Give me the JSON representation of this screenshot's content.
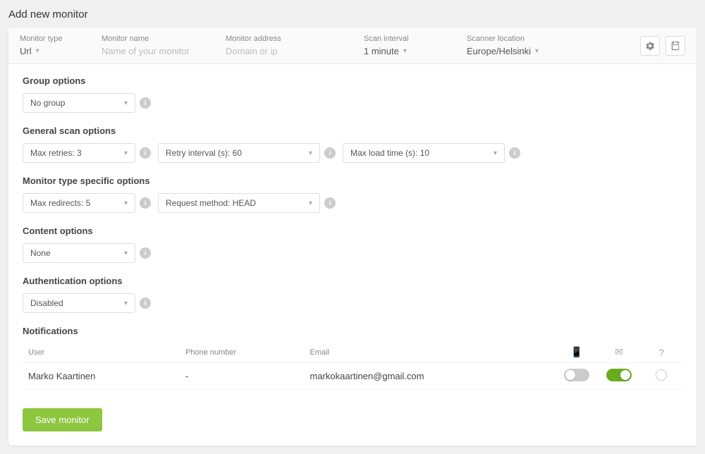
{
  "page": {
    "title": "Add new monitor"
  },
  "top_bar": {
    "monitor_type_label": "Monitor type",
    "monitor_name_label": "Monitor name",
    "monitor_address_label": "Monitor address",
    "scan_interval_label": "Scan interval",
    "scanner_location_label": "Scanner location",
    "monitor_type_value": "Url",
    "monitor_name_placeholder": "Name of your monitor",
    "monitor_address_placeholder": "Domain or ip",
    "scan_interval_value": "1 minute",
    "scanner_location_value": "Europe/Helsinki"
  },
  "sections": {
    "group_options": {
      "title": "Group options",
      "dropdown": "No group"
    },
    "general_scan": {
      "title": "General scan options",
      "max_retries": "Max retries: 3",
      "retry_interval": "Retry interval (s): 60",
      "max_load_time": "Max load time (s): 10"
    },
    "monitor_type_specific": {
      "title": "Monitor type specific options",
      "max_redirects": "Max redirects: 5",
      "request_method": "Request method: HEAD"
    },
    "content_options": {
      "title": "Content options",
      "dropdown": "None"
    },
    "authentication_options": {
      "title": "Authentication options",
      "dropdown": "Disabled"
    },
    "notifications": {
      "title": "Notifications",
      "columns": {
        "user": "User",
        "phone": "Phone number",
        "email": "Email",
        "phone_icon": "📱",
        "email_icon": "✉",
        "question_icon": "?"
      },
      "rows": [
        {
          "user": "Marko Kaartinen",
          "phone": "-",
          "email": "markokaartinen@gmail.com",
          "phone_toggle": false,
          "email_toggle": true,
          "question_toggle": false
        }
      ]
    }
  },
  "buttons": {
    "save": "Save monitor"
  }
}
